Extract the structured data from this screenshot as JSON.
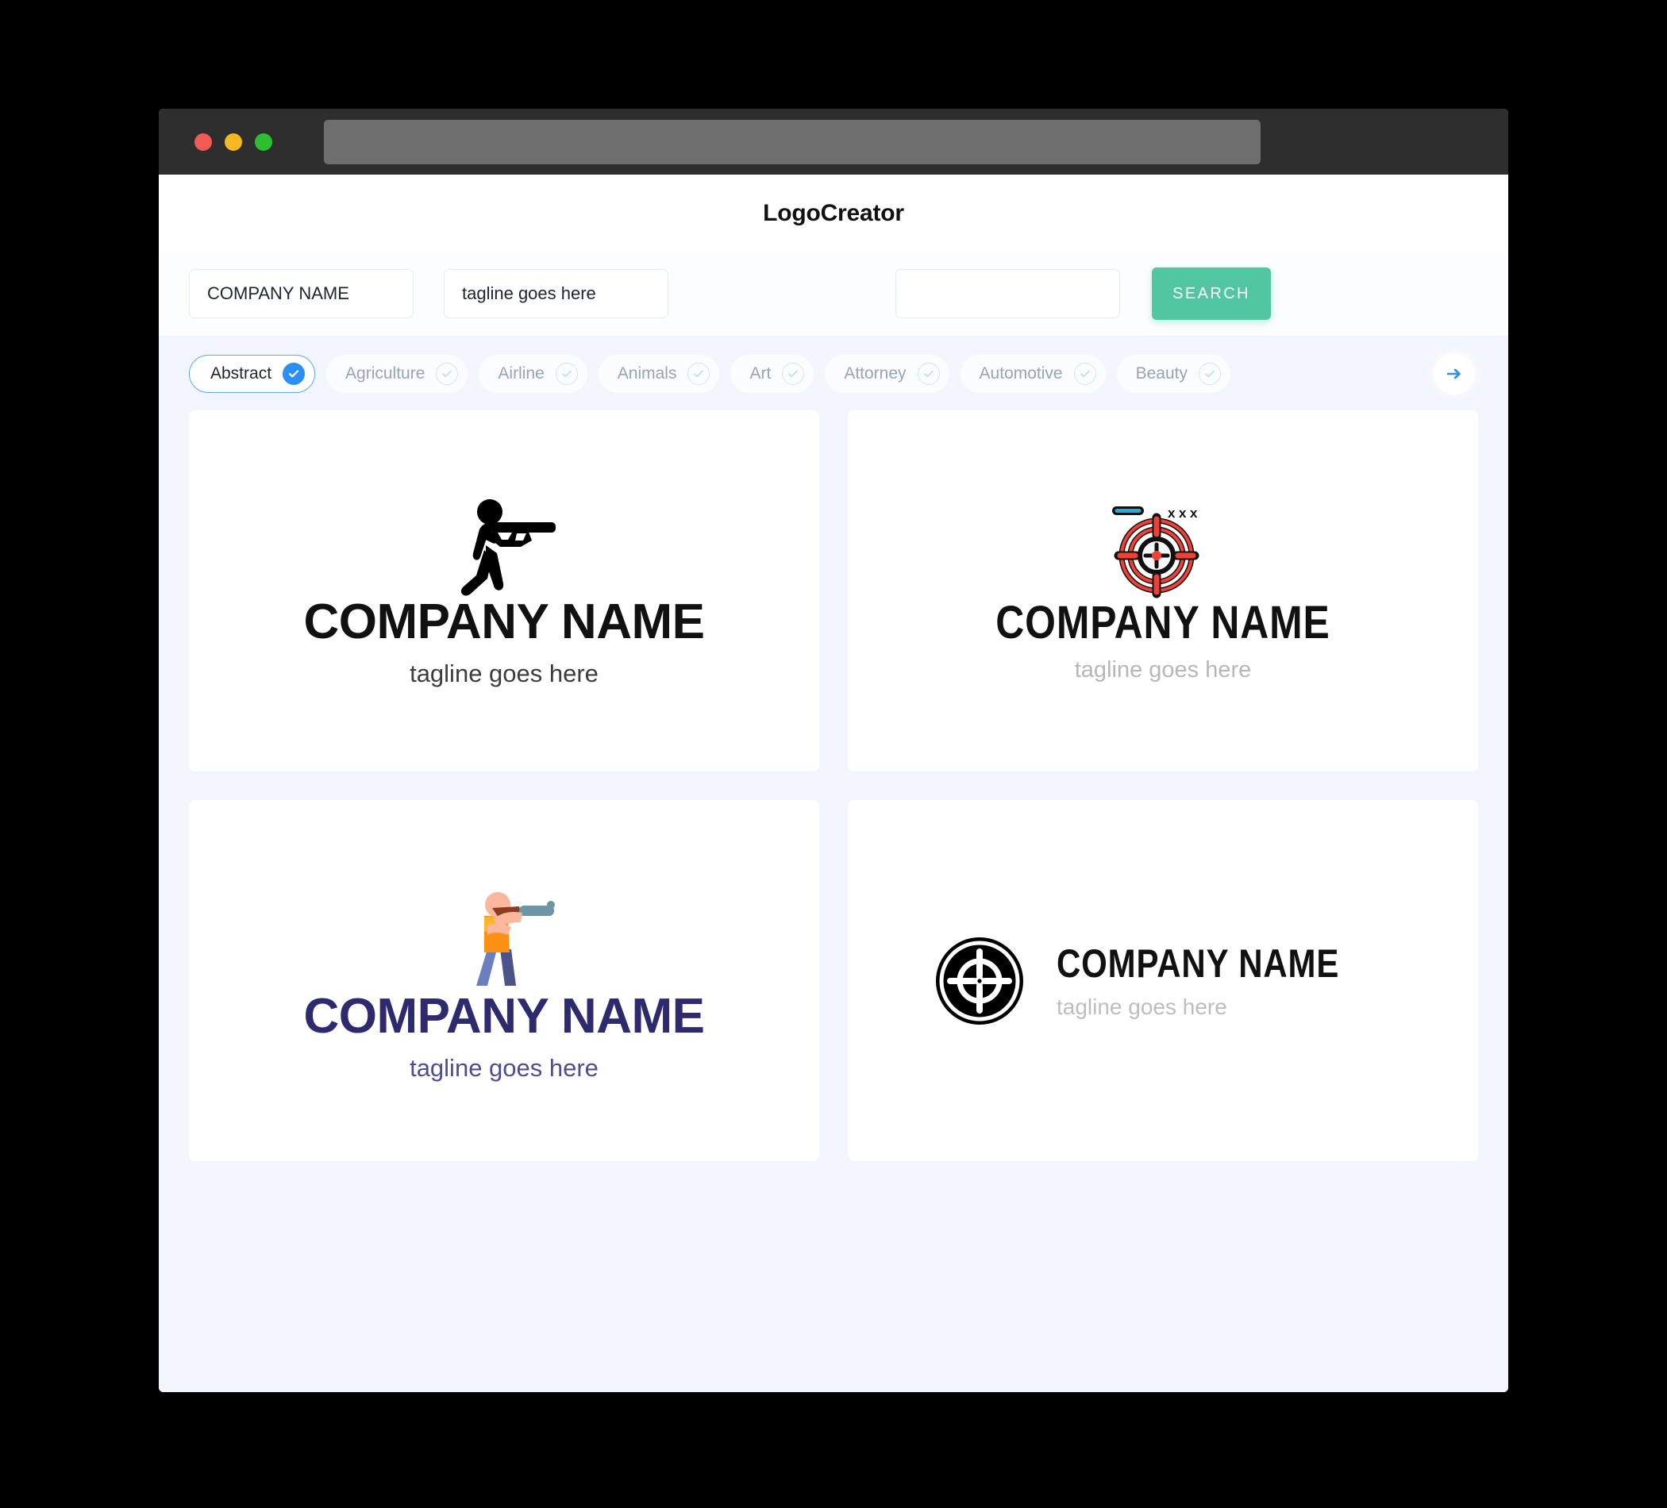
{
  "window": {
    "traffic_lights": [
      "close",
      "minimize",
      "zoom"
    ],
    "url_value": ""
  },
  "header": {
    "title": "LogoCreator"
  },
  "search": {
    "company_value": "COMPANY NAME",
    "company_placeholder": "COMPANY NAME",
    "tagline_value": "tagline goes here",
    "tagline_placeholder": "tagline goes here",
    "extra_value": "",
    "extra_placeholder": "",
    "button_label": "SEARCH",
    "button_color": "#52c6a0"
  },
  "categories": {
    "selected": "Abstract",
    "next_label": "next",
    "accent": "#2b8ff5",
    "items": [
      {
        "label": "Abstract",
        "selected": true
      },
      {
        "label": "Agriculture",
        "selected": false
      },
      {
        "label": "Airline",
        "selected": false
      },
      {
        "label": "Animals",
        "selected": false
      },
      {
        "label": "Art",
        "selected": false
      },
      {
        "label": "Attorney",
        "selected": false
      },
      {
        "label": "Automotive",
        "selected": false
      },
      {
        "label": "Beauty",
        "selected": false
      }
    ]
  },
  "results": {
    "logos": [
      {
        "id": "logo-shooter-black",
        "mark": "shooter-silhouette-icon",
        "layout": "stacked",
        "name": "COMPANY NAME",
        "tagline": "tagline goes here",
        "name_color": "#111111",
        "tagline_color": "#3c3c3c"
      },
      {
        "id": "logo-target-red",
        "mark": "red-crosshair-target-icon",
        "layout": "stacked",
        "name": "COMPANY NAME",
        "tagline": "tagline goes here",
        "name_color": "#111111",
        "tagline_color": "#b7b7b7"
      },
      {
        "id": "logo-shooter-color",
        "mark": "flat-shooter-illustration-icon",
        "layout": "stacked",
        "name": "COMPANY NAME",
        "tagline": "tagline goes here",
        "name_color": "#2d2a6e",
        "tagline_color": "#4f4d91"
      },
      {
        "id": "logo-target-black",
        "mark": "black-crosshair-badge-icon",
        "layout": "horizontal",
        "name": "COMPANY NAME",
        "tagline": "tagline goes here",
        "name_color": "#111111",
        "tagline_color": "#bdbdbd"
      }
    ]
  }
}
